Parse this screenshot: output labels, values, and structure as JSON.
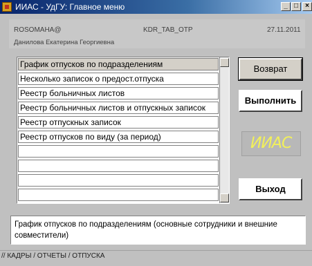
{
  "window": {
    "title": "ИИАС - УдГУ: Главное меню",
    "controls": {
      "minimize": "_",
      "maximize": "□",
      "close": "×"
    }
  },
  "header": {
    "user": "ROSOMAHA@",
    "form_code": "KDR_TAB_OTP",
    "date": "27.11.2011",
    "full_name": "Данилова Екатерина Георгиевна"
  },
  "menu": {
    "items": [
      {
        "label": "График отпусков по подразделениям",
        "selected": true
      },
      {
        "label": "Несколько записок о предост.отпуска",
        "selected": false
      },
      {
        "label": "Реестр больничных листов",
        "selected": false
      },
      {
        "label": "Реестр больничных листов и отпускных записок",
        "selected": false
      },
      {
        "label": "Реестр отпускных записок",
        "selected": false
      },
      {
        "label": "Реестр отпусков по виду (за период)",
        "selected": false
      },
      {
        "label": "",
        "selected": false
      },
      {
        "label": "",
        "selected": false
      },
      {
        "label": "",
        "selected": false
      },
      {
        "label": "",
        "selected": false
      }
    ]
  },
  "buttons": {
    "back": "Возврат",
    "run": "Выполнить",
    "exit": "Выход"
  },
  "logo": {
    "text": "ИИАС",
    "color": "#f2f05a"
  },
  "description": "График отпусков по подразделениям (основные сотрудники и внешние совместители)",
  "status_path": "// КАДРЫ / ОТЧЕТЫ / ОТПУСКА"
}
